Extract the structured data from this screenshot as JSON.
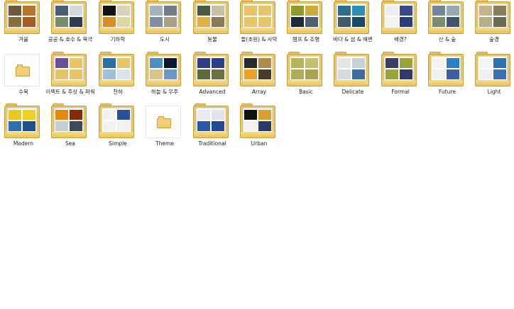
{
  "folders": [
    {
      "label": "겨울",
      "thumbs": [
        "#6e5a3c",
        "#b6762e",
        "#8c6b3f",
        "#a65a25"
      ]
    },
    {
      "label": "공공 & 호수 & 북극",
      "thumbs": [
        "#4a5d72",
        "#cfd8df",
        "#7a8b6a",
        "#2f3d52"
      ]
    },
    {
      "label": "기하학",
      "thumbs": [
        "#111111",
        "#d9d2b8",
        "#e08a26",
        "#dcd7a5"
      ]
    },
    {
      "label": "도시",
      "thumbs": [
        "#a8b2ba",
        "#6f7c88",
        "#7f8f9e",
        "#a89f86"
      ]
    },
    {
      "label": "동물",
      "thumbs": [
        "#4b5a3f",
        "#c8c0a4",
        "#e0b040",
        "#8a7a57"
      ]
    },
    {
      "label": "들(초원) & 사막",
      "thumbs": [
        "#e7c468",
        "#e7c468",
        "#e7c468",
        "#e7c468"
      ]
    },
    {
      "label": "램프 & 조명",
      "thumbs": [
        "#8e9b2b",
        "#c9ad3b",
        "#1d2a3a",
        "#4c5f73"
      ]
    },
    {
      "label": "바다 & 섬 & 해변",
      "thumbs": [
        "#2d6d8f",
        "#2b8fb8",
        "#3e5d6c",
        "#1a4a66"
      ]
    },
    {
      "label": "배경?",
      "thumbs": [
        "#ececf3",
        "#3a4a8a",
        "#f3f3f3",
        "#2c3e78"
      ]
    },
    {
      "label": "산 & 숲",
      "thumbs": [
        "#6f8798",
        "#97a9b4",
        "#7b8e6b",
        "#3f5569"
      ]
    },
    {
      "label": "숲경",
      "thumbs": [
        "#c6b38a",
        "#8a7d5c",
        "#b8ad8a",
        "#6d6a55"
      ]
    },
    {
      "label": "수묵",
      "plain": true
    },
    {
      "label": "이펙트 & 추상 & 파워",
      "thumbs": [
        "#6a4f9a",
        "#e7c468",
        "#e7c468",
        "#e7c468"
      ]
    },
    {
      "label": "천하",
      "thumbs": [
        "#2f6ea3",
        "#e7c468",
        "#9fbedb",
        "#d9e3ec"
      ]
    },
    {
      "label": "하늘 & 우주",
      "thumbs": [
        "#4f8fbf",
        "#0c1830",
        "#d9c58a",
        "#6e98c2"
      ]
    },
    {
      "label": "Advanced",
      "thumbs": [
        "#2f3f85",
        "#2f3f85",
        "#5a6a3a",
        "#6d7142"
      ]
    },
    {
      "label": "Array",
      "thumbs": [
        "#2a2a2a",
        "#b08a4a",
        "#e9a22a",
        "#4a3a2a"
      ]
    },
    {
      "label": "Basic",
      "thumbs": [
        "#b8b35a",
        "#c4c070",
        "#b0ab55",
        "#a8a24e"
      ]
    },
    {
      "label": "Delicate",
      "thumbs": [
        "#e6e6e6",
        "#c8d0d8",
        "#d4dae0",
        "#3f6f9f"
      ]
    },
    {
      "label": "Formal",
      "thumbs": [
        "#3a3f6a",
        "#9aa23a",
        "#9aa23a",
        "#2f3a66"
      ]
    },
    {
      "label": "Future",
      "thumbs": [
        "#f3f3f3",
        "#2f7fc2",
        "#f0f0f0",
        "#3f5f9f"
      ]
    },
    {
      "label": "Light",
      "thumbs": [
        "#f4f4f4",
        "#2f6fb2",
        "#eeeeee",
        "#3f6faf"
      ]
    },
    {
      "label": "Modern",
      "thumbs": [
        "#e8c820",
        "#f0d020",
        "#2e6fae",
        "#1f4f8f"
      ]
    },
    {
      "label": "Sea",
      "thumbs": [
        "#e28a10",
        "#8a2a05",
        "#c7cdd4",
        "#3a4a5a"
      ]
    },
    {
      "label": "Simple",
      "thumbs": [
        "#f2f2f2",
        "#2c4f9a",
        "#f2f2f2",
        "#f2f2f2"
      ]
    },
    {
      "label": "Theme",
      "plain": true
    },
    {
      "label": "Traditional",
      "thumbs": [
        "#e9ebef",
        "#dfe3ea",
        "#2a58a8",
        "#1f4a94"
      ]
    },
    {
      "label": "Urban",
      "thumbs": [
        "#111111",
        "#d9a030",
        "#f2f2f2",
        "#2b3a6a"
      ]
    }
  ]
}
